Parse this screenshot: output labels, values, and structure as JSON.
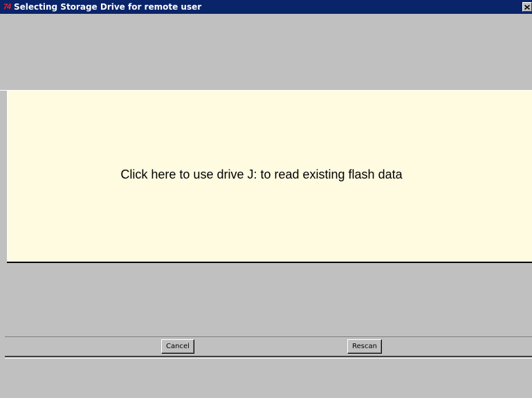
{
  "window": {
    "title": "Selecting Storage Drive for remote user",
    "app_icon_glyph": "74",
    "close_icon": "close-icon"
  },
  "colors": {
    "titlebar": "#0a246a",
    "panel": "#c0c0c0",
    "drive_panel": "#fffbe1",
    "app_icon": "#ff2020"
  },
  "drive_panel": {
    "label": "Click here to use drive J: to read existing flash data"
  },
  "buttons": {
    "cancel_label": "Cancel",
    "rescan_label": "Rescan"
  }
}
